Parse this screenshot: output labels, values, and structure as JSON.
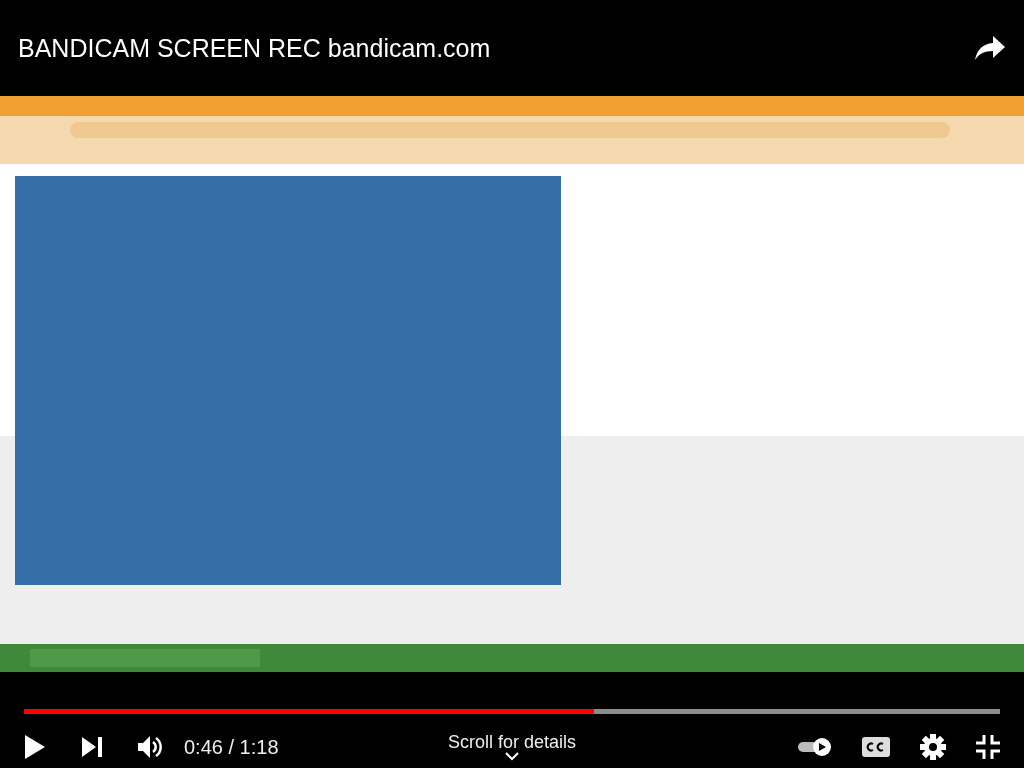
{
  "video": {
    "title": "BANDICAM SCREEN REC bandicam.com"
  },
  "player": {
    "progress": {
      "level": 0.584
    },
    "time": "0:46 / 1:18",
    "scroll_hint": "Scroll for details",
    "autoplay": {
      "on": true
    }
  }
}
